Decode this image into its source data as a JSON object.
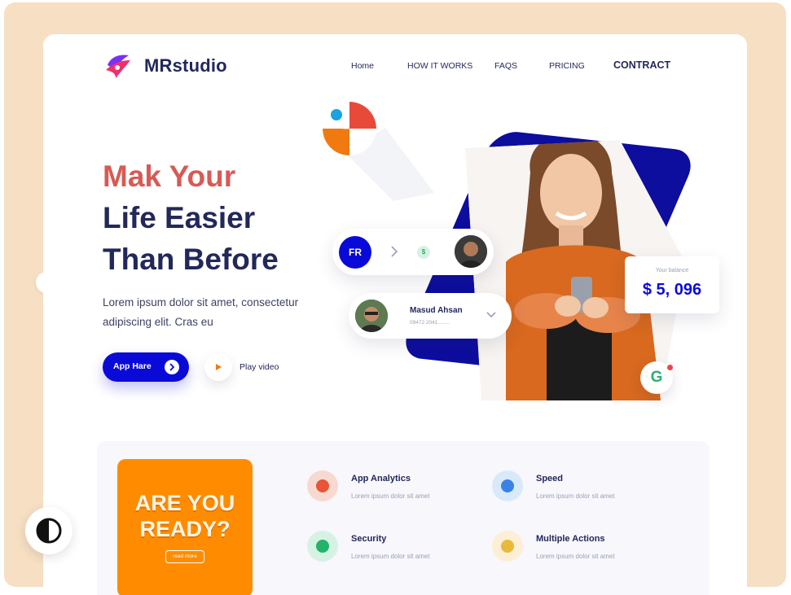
{
  "brand": {
    "name": "MRstudio",
    "logo": "mr-logo-icon"
  },
  "nav": {
    "items": [
      "Home",
      "HOW IT WORKS",
      "FAQS",
      "PRICING"
    ],
    "contract": "CONTRACT"
  },
  "hero": {
    "line1": "Mak Your",
    "line2": "Life Easier",
    "line3": "Than Before",
    "description": "Lorem ipsum dolor sit amet, consectetur adipiscing elit. Cras eu",
    "primary_button": "App Hare",
    "play_label": "Play video"
  },
  "transfer_card": {
    "initials": "FR",
    "currency_badge": "$"
  },
  "contact_card": {
    "name": "Masud Ahsan",
    "number": "09472 2041........"
  },
  "balance_card": {
    "label": "Your balance",
    "amount": "$ 5, 096"
  },
  "google_badge": {
    "letter": "G"
  },
  "promo": {
    "line1": "ARE YOU",
    "line2": "READY?",
    "button": "read more"
  },
  "features": [
    {
      "title": "App Analytics",
      "desc": "Lorem ipsum dolor sit amet",
      "icon": "analytics-icon",
      "color": "#f7d9cf",
      "accent": "#e8553b"
    },
    {
      "title": "Speed",
      "desc": "Lorem ipsum dolor sit amet",
      "icon": "rocket-icon",
      "color": "#d8e9fa",
      "accent": "#3b82e8"
    },
    {
      "title": "Security",
      "desc": "Lorem ipsum dolor sit amet",
      "icon": "shield-icon",
      "color": "#d6f2e3",
      "accent": "#22b46a"
    },
    {
      "title": "Multiple Actions",
      "desc": "Lorem ipsum dolor sit amet",
      "icon": "hand-icon",
      "color": "#fcefd6",
      "accent": "#e8b93b"
    }
  ],
  "colors": {
    "accent": "#0a0ad8",
    "red": "#d75a55",
    "navy": "#23285a",
    "orange": "#ff8c00",
    "frame": "#f6dfc3"
  }
}
